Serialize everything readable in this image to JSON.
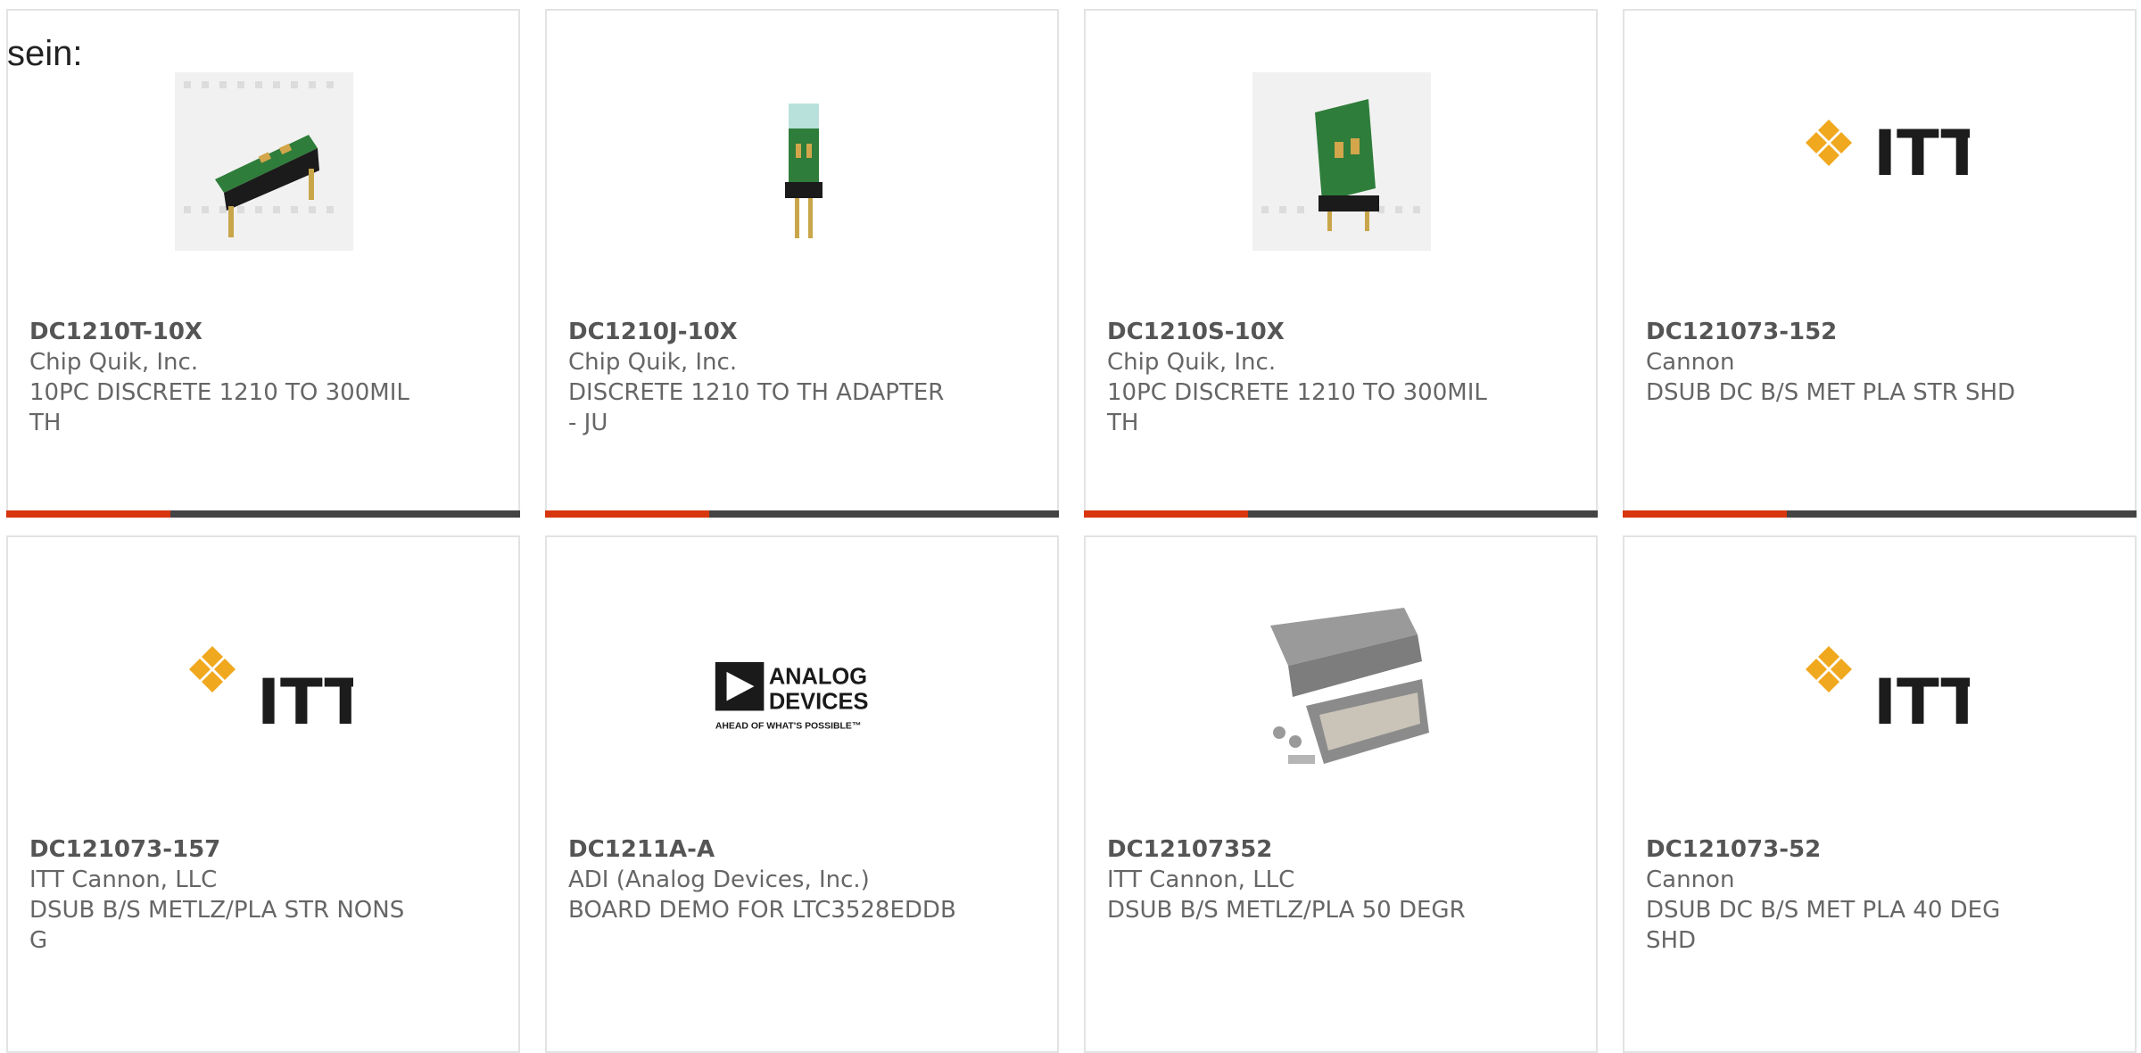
{
  "fragment_text": "sein:",
  "accent_color": "#d8360f",
  "bar_color": "#444444",
  "products": [
    {
      "part": "DC1210T-10X",
      "mfr": "Chip Quik, Inc.",
      "desc1": "10PC DISCRETE 1210 TO 300MIL",
      "desc2": "TH",
      "image": "breadboard-adapter-photo"
    },
    {
      "part": "DC1210J-10X",
      "mfr": "Chip Quik, Inc.",
      "desc1": "DISCRETE 1210 TO TH ADAPTER",
      "desc2": "- JU",
      "image": "jumper-adapter-photo"
    },
    {
      "part": "DC1210S-10X",
      "mfr": "Chip Quik, Inc.",
      "desc1": "10PC DISCRETE 1210 TO 300MIL",
      "desc2": "TH",
      "image": "proto-advantage-adapter-photo"
    },
    {
      "part": "DC121073-152",
      "mfr": "Cannon",
      "desc1": "DSUB DC B/S MET PLA STR SHD",
      "desc2": "",
      "image": "itt-logo"
    },
    {
      "part": "DC121073-157",
      "mfr": "ITT Cannon, LLC",
      "desc1": "DSUB B/S METLZ/PLA STR NONS",
      "desc2": "G",
      "image": "itt-logo"
    },
    {
      "part": "DC1211A-A",
      "mfr": "ADI (Analog Devices, Inc.)",
      "desc1": "BOARD DEMO FOR LTC3528EDDB",
      "desc2": "",
      "image": "analog-devices-logo"
    },
    {
      "part": "DC12107352",
      "mfr": "ITT Cannon, LLC",
      "desc1": "DSUB B/S METLZ/PLA 50 DEGR",
      "desc2": "",
      "image": "dsub-backshell-photo"
    },
    {
      "part": "DC121073-52",
      "mfr": "Cannon",
      "desc1": "DSUB DC B/S MET PLA 40 DEG",
      "desc2": "SHD",
      "image": "itt-logo"
    }
  ]
}
